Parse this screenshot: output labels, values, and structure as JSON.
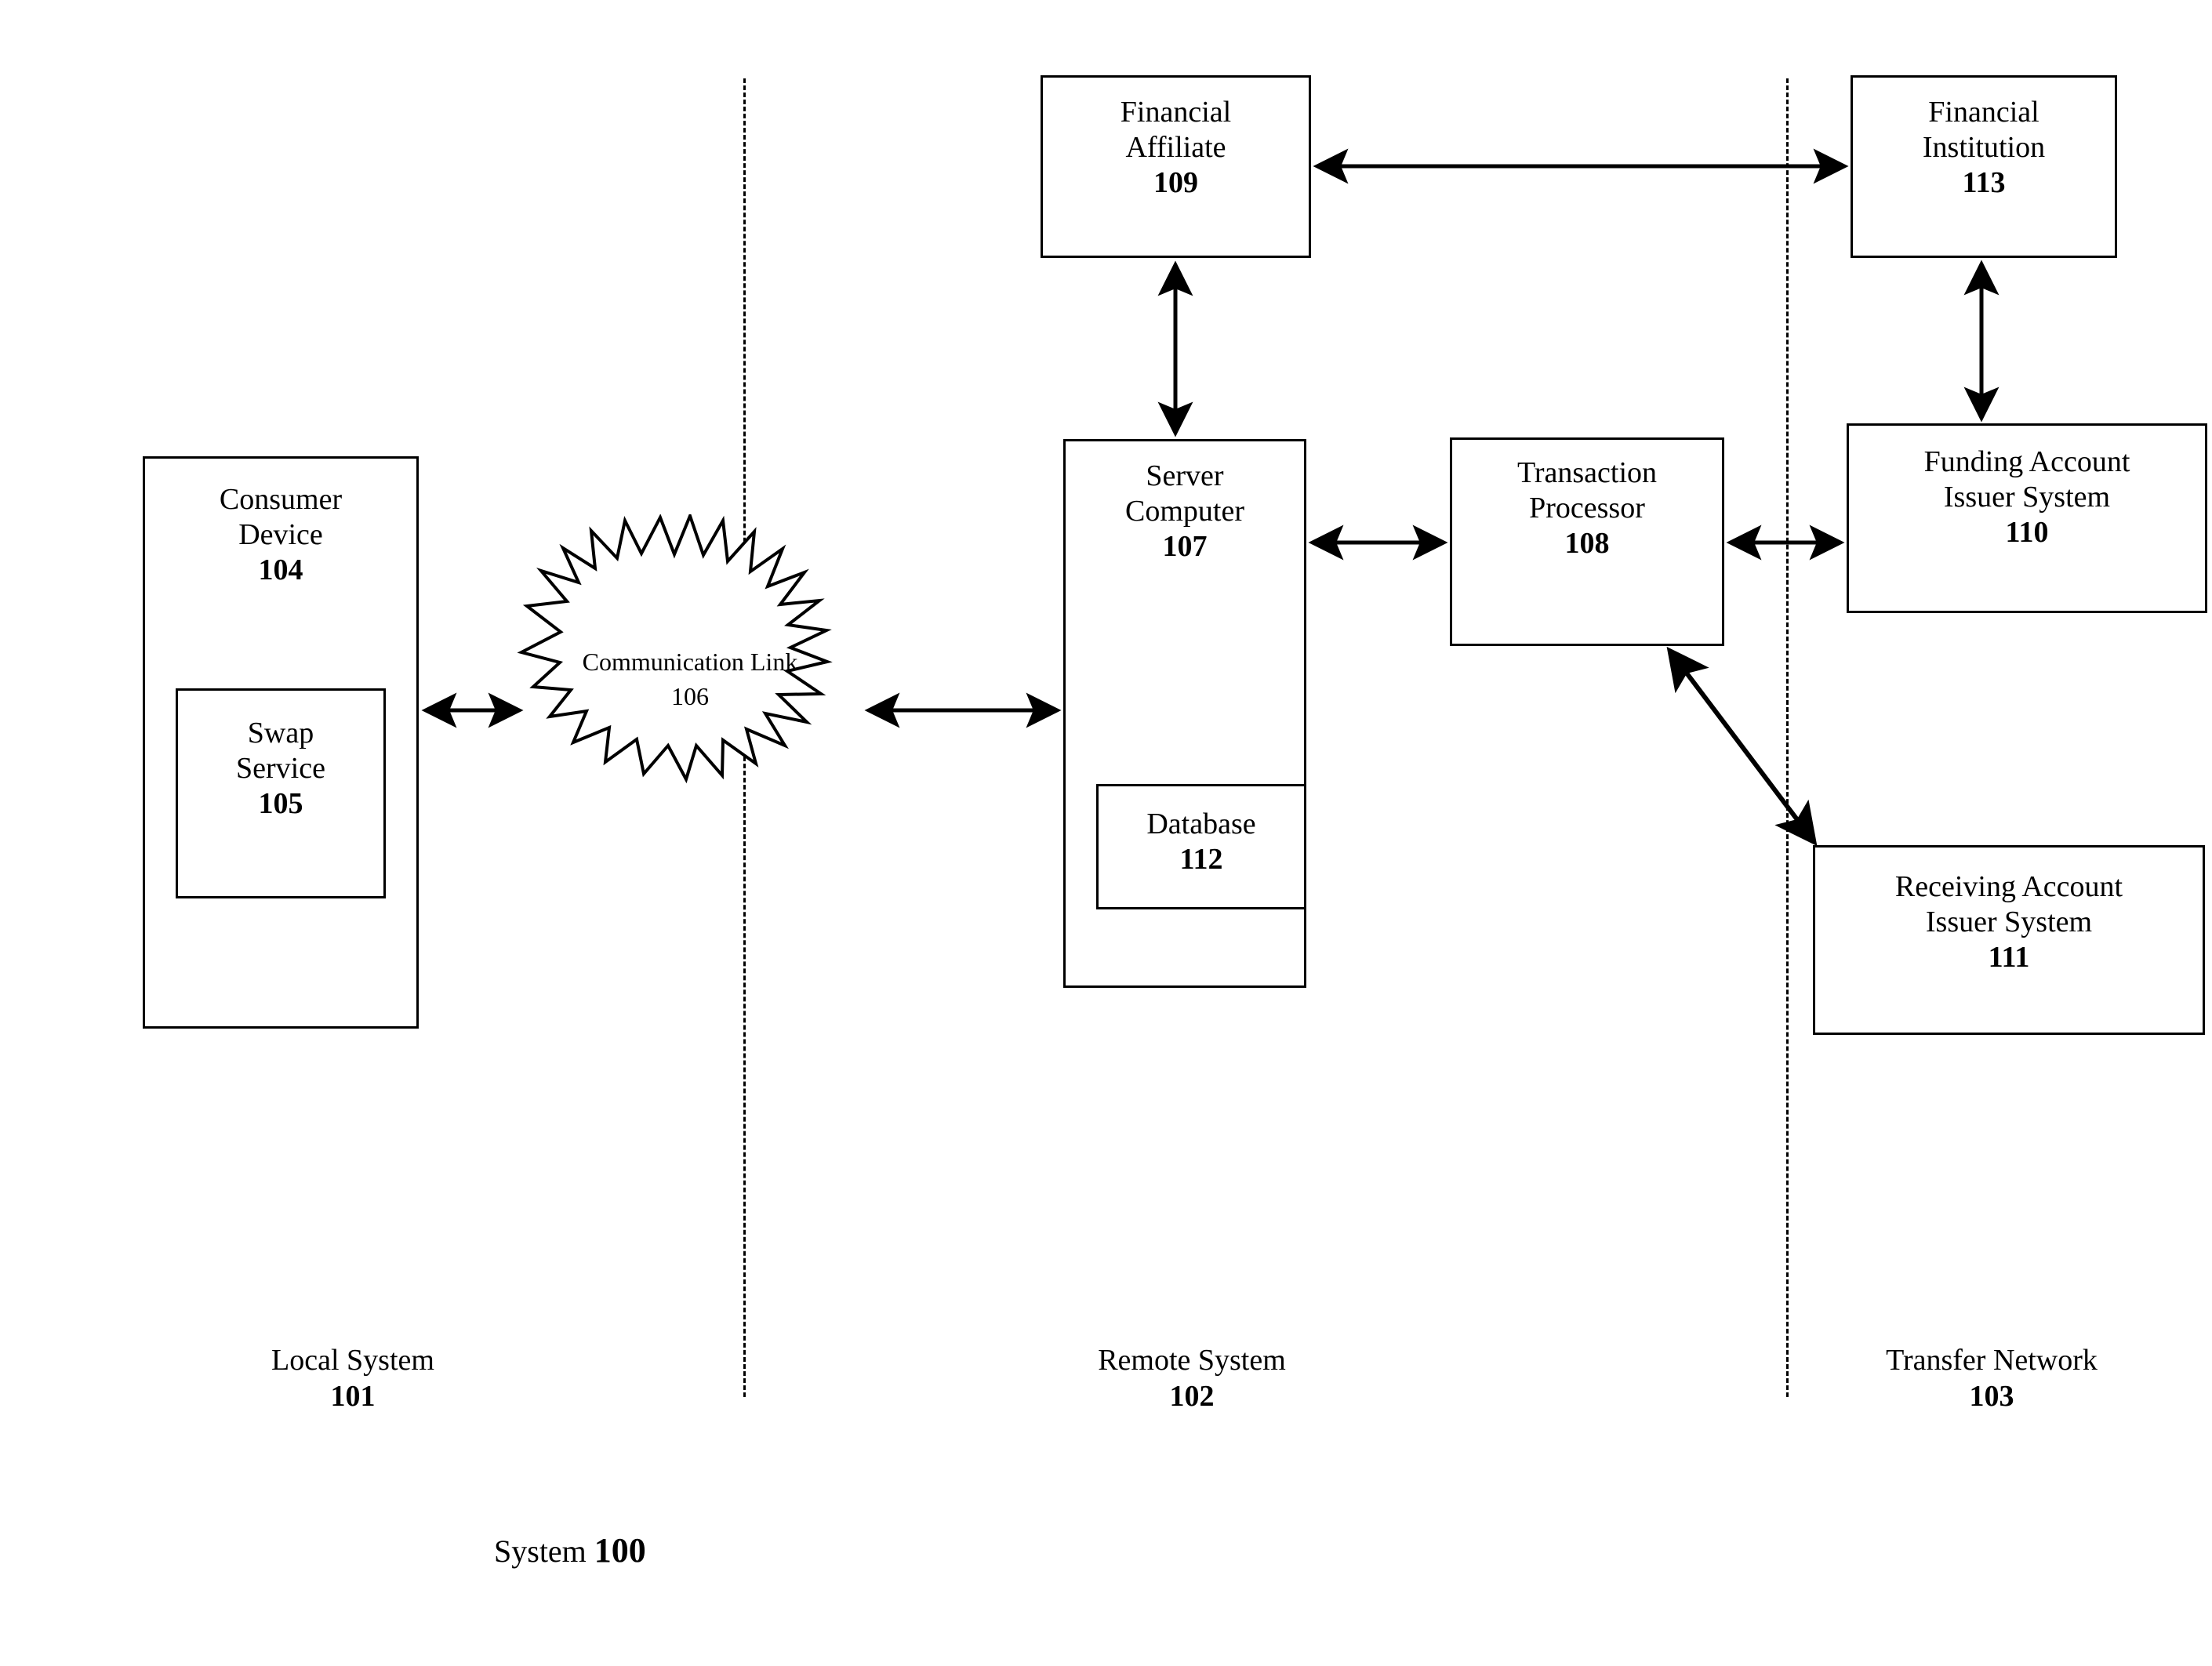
{
  "figure": {
    "caption_text": "System ",
    "caption_number": "100"
  },
  "zones": [
    {
      "name": "Local System",
      "ref": "101"
    },
    {
      "name": "Remote System",
      "ref": "102"
    },
    {
      "name": "Transfer Network",
      "ref": "103"
    }
  ],
  "nodes": {
    "consumer_device": {
      "label": "Consumer\nDevice",
      "ref": "104"
    },
    "swap_service": {
      "label": "Swap\nService",
      "ref": "105"
    },
    "communication_link": {
      "label": "Communication\nLink",
      "ref": "106"
    },
    "server_computer": {
      "label": "Server\nComputer",
      "ref": "107"
    },
    "database": {
      "label": "Database",
      "ref": "112"
    },
    "transaction_processor": {
      "label": "Transaction\nProcessor",
      "ref": "108"
    },
    "financial_affiliate": {
      "label": "Financial\nAffiliate",
      "ref": "109"
    },
    "financial_institution": {
      "label": "Financial\nInstitution",
      "ref": "113"
    },
    "funding_account": {
      "label": "Funding Account\nIssuer System",
      "ref": "110"
    },
    "receiving_account": {
      "label": "Receiving Account\nIssuer System",
      "ref": "111"
    }
  },
  "connections": [
    {
      "from": "consumer_device",
      "to": "communication_link",
      "style": "double-arrow"
    },
    {
      "from": "communication_link",
      "to": "server_computer",
      "style": "double-arrow"
    },
    {
      "from": "server_computer",
      "to": "financial_affiliate",
      "style": "double-arrow"
    },
    {
      "from": "server_computer",
      "to": "transaction_processor",
      "style": "double-arrow"
    },
    {
      "from": "financial_affiliate",
      "to": "financial_institution",
      "style": "double-arrow"
    },
    {
      "from": "financial_institution",
      "to": "funding_account",
      "style": "double-arrow"
    },
    {
      "from": "transaction_processor",
      "to": "funding_account",
      "style": "double-arrow"
    },
    {
      "from": "transaction_processor",
      "to": "receiving_account",
      "style": "double-arrow-diagonal"
    }
  ],
  "colors": {
    "line": "#000000",
    "background": "#ffffff"
  }
}
